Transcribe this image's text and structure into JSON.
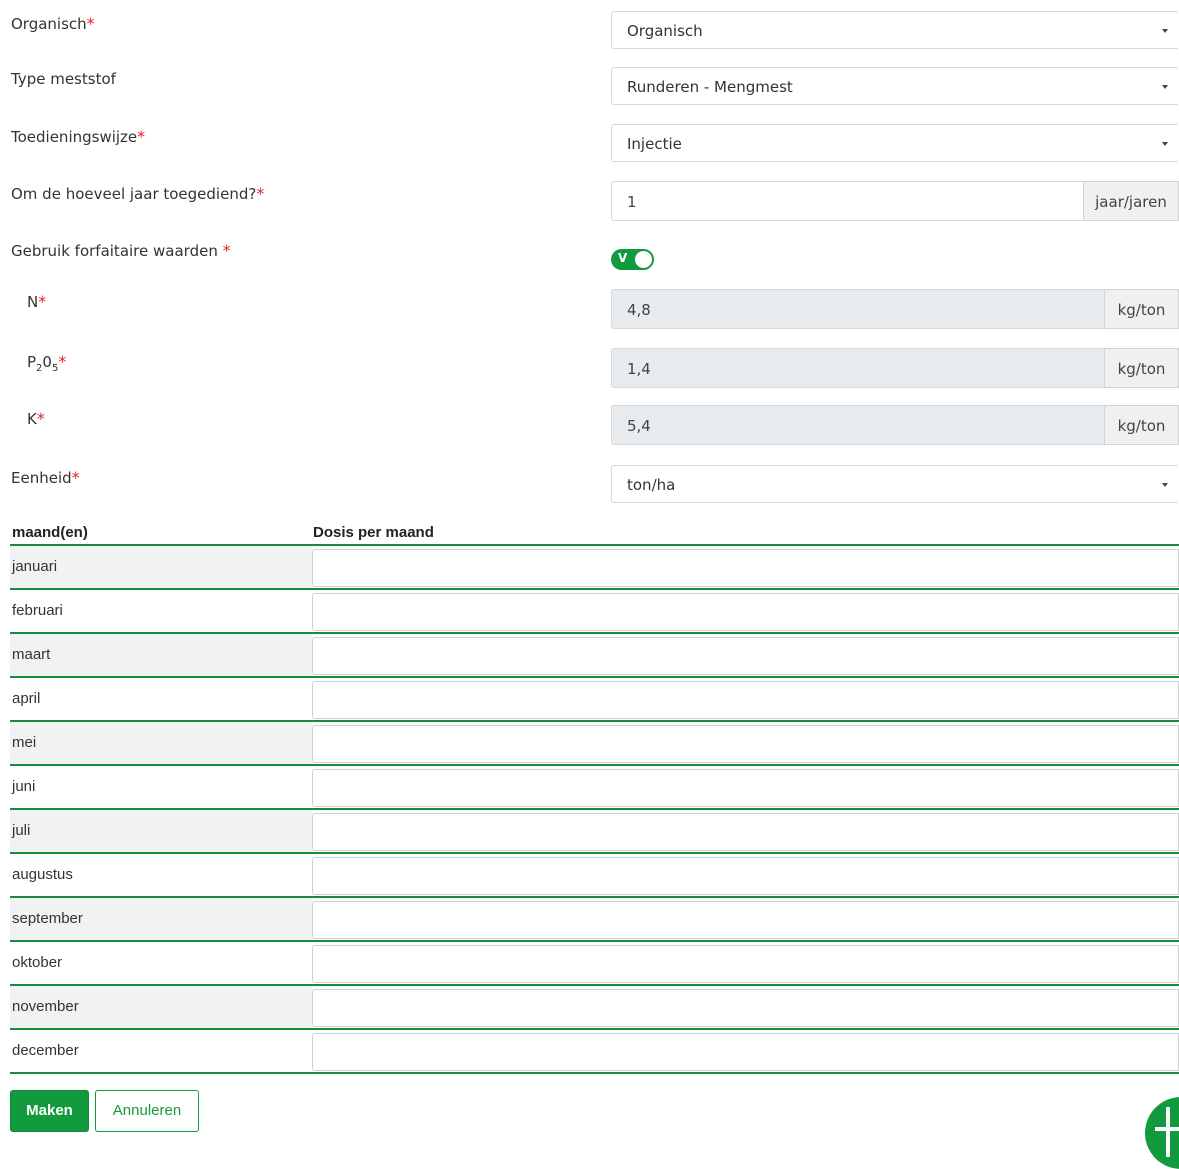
{
  "form": {
    "required_mark": "*",
    "organisch": {
      "label": "Organisch",
      "value": "Organisch"
    },
    "type_meststof": {
      "label": "Type meststof",
      "value": "Runderen - Mengmest"
    },
    "toedieningswijze": {
      "label": "Toedieningswijze",
      "value": "Injectie"
    },
    "interval": {
      "label": "Om de hoeveel jaar toegediend?",
      "value": "1",
      "unit": "jaar/jaren"
    },
    "forfaitair": {
      "label": "Gebruik forfaitaire waarden ",
      "toggle_text": "V",
      "enabled": true
    },
    "n": {
      "label": "N",
      "value": "4,8",
      "unit": "kg/ton"
    },
    "p2o5": {
      "label_p": "P",
      "sub1": "2",
      "label_o": "0",
      "sub2": "5",
      "value": "1,4",
      "unit": "kg/ton"
    },
    "k": {
      "label": "K",
      "value": "5,4",
      "unit": "kg/ton"
    },
    "eenheid": {
      "label": "Eenheid",
      "value": "ton/ha"
    }
  },
  "table": {
    "col_month": "maand(en)",
    "col_dose": "Dosis per maand",
    "months": [
      "januari",
      "februari",
      "maart",
      "april",
      "mei",
      "juni",
      "juli",
      "augustus",
      "september",
      "oktober",
      "november",
      "december"
    ]
  },
  "actions": {
    "create": "Maken",
    "cancel": "Annuleren"
  },
  "colors": {
    "accent": "#129a3e",
    "required": "#e8202a",
    "row_shade": "#f2f2f2"
  }
}
